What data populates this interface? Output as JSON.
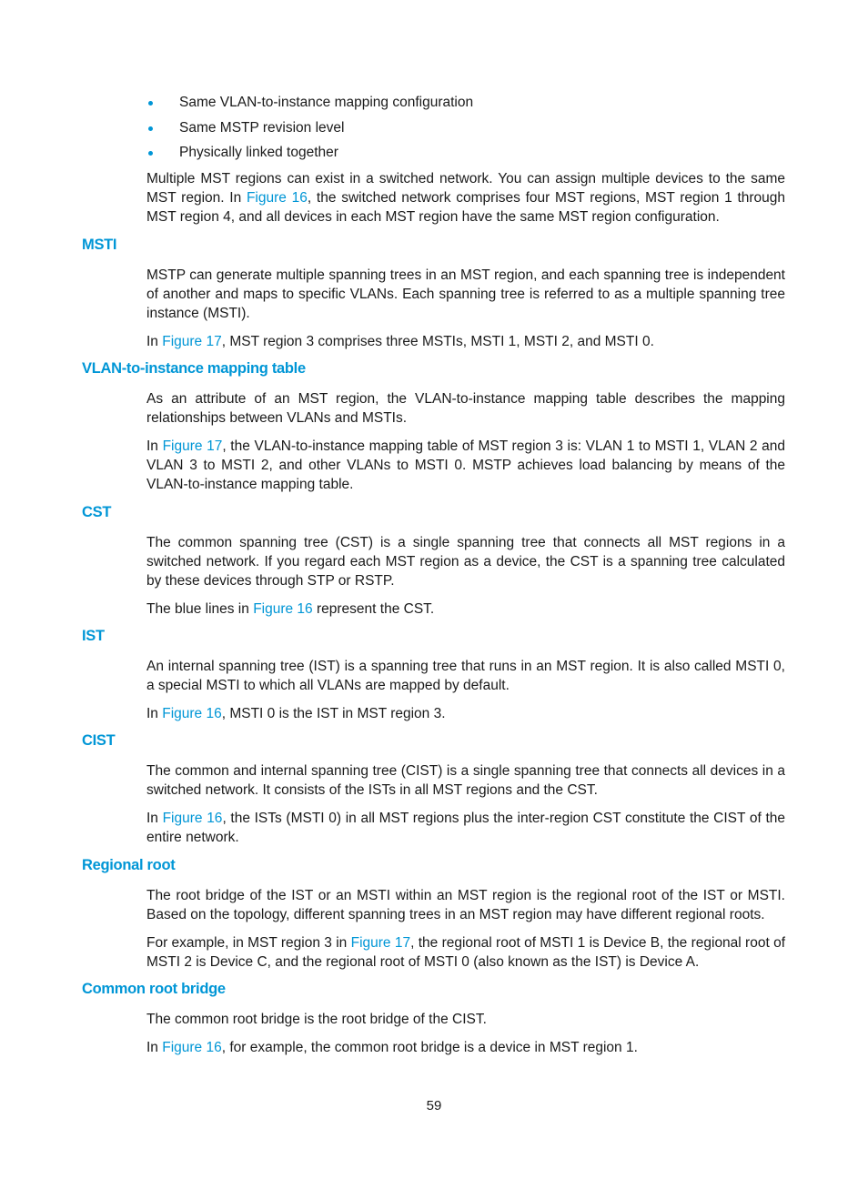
{
  "bullets": [
    "Same VLAN-to-instance mapping configuration",
    "Same MSTP revision level",
    "Physically linked together"
  ],
  "intro": {
    "pre": "Multiple MST regions can exist in a switched network. You can assign multiple devices to the same MST region. In ",
    "link": "Figure 16",
    "post": ", the switched network comprises four MST regions, MST region 1 through MST region 4, and all devices in each MST region have the same MST region configuration."
  },
  "sections": {
    "msti": {
      "heading": "MSTI",
      "p1": "MSTP can generate multiple spanning trees in an MST region, and each spanning tree is independent of another and maps to specific VLANs. Each spanning tree is referred to as a multiple spanning tree instance (MSTI).",
      "p2_pre": "In ",
      "p2_link": "Figure 17",
      "p2_post": ", MST region 3 comprises three MSTIs, MSTI 1, MSTI 2, and MSTI 0."
    },
    "vlan_map": {
      "heading": "VLAN-to-instance mapping table",
      "p1": "As an attribute of an MST region, the VLAN-to-instance mapping table describes the mapping relationships between VLANs and MSTIs.",
      "p2_pre": "In ",
      "p2_link": "Figure 17",
      "p2_post": ", the VLAN-to-instance mapping table of MST region 3 is: VLAN 1 to MSTI 1, VLAN 2 and VLAN 3 to MSTI 2, and other VLANs to MSTI 0. MSTP achieves load balancing by means of the VLAN-to-instance mapping table."
    },
    "cst": {
      "heading": "CST",
      "p1": "The common spanning tree (CST) is a single spanning tree that connects all MST regions in a switched network. If you regard each MST region as a device, the CST is a spanning tree calculated by these devices through STP or RSTP.",
      "p2_pre": "The blue lines in ",
      "p2_link": "Figure 16",
      "p2_post": " represent the CST."
    },
    "ist": {
      "heading": "IST",
      "p1": "An internal spanning tree (IST) is a spanning tree that runs in an MST region. It is also called MSTI 0, a special MSTI to which all VLANs are mapped by default.",
      "p2_pre": "In ",
      "p2_link": "Figure 16",
      "p2_post": ", MSTI 0 is the IST in MST region 3."
    },
    "cist": {
      "heading": "CIST",
      "p1": "The common and internal spanning tree (CIST) is a single spanning tree that connects all devices in a switched network. It consists of the ISTs in all MST regions and the CST.",
      "p2_pre": "In ",
      "p2_link": "Figure 16",
      "p2_post": ", the ISTs (MSTI 0) in all MST regions plus the inter-region CST constitute the CIST of the entire network."
    },
    "regional_root": {
      "heading": "Regional root",
      "p1": "The root bridge of the IST or an MSTI within an MST region is the regional root of the IST or MSTI. Based on the topology, different spanning trees in an MST region may have different regional roots.",
      "p2_pre": "For example, in MST region 3 in ",
      "p2_link": "Figure 17",
      "p2_post": ", the regional root of MSTI 1 is Device B, the regional root of MSTI 2 is Device C, and the regional root of MSTI 0 (also known as the IST) is Device A."
    },
    "common_root": {
      "heading": "Common root bridge",
      "p1": "The common root bridge is the root bridge of the CIST.",
      "p2_pre": "In ",
      "p2_link": "Figure 16",
      "p2_post": ", for example, the common root bridge is a device in MST region 1."
    }
  },
  "page_number": "59"
}
